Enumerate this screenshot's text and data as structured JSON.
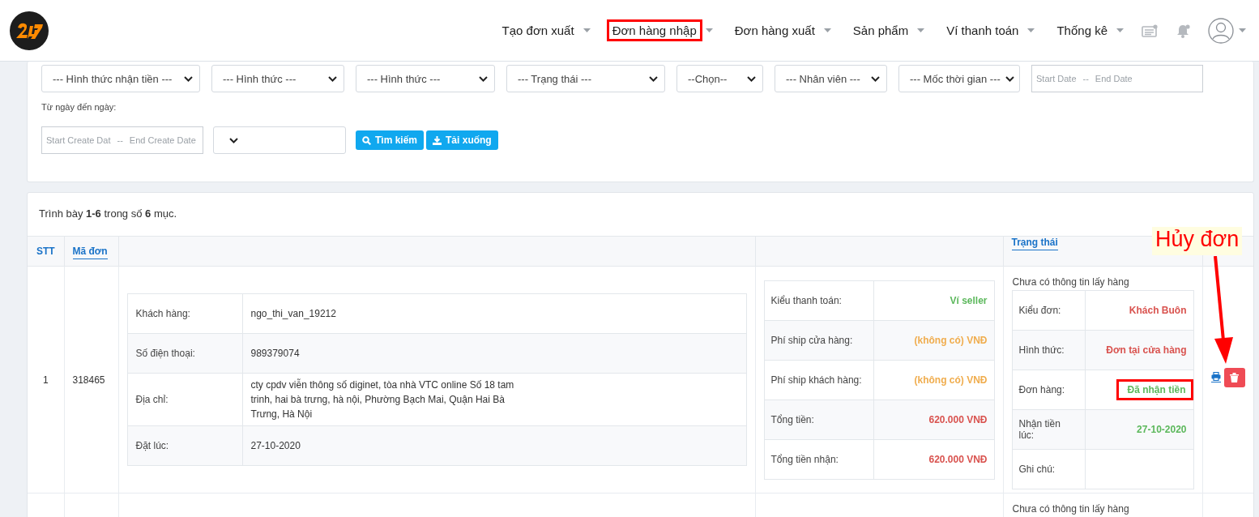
{
  "header": {
    "nav": [
      {
        "label": "Tạo đơn xuất",
        "highlighted": false
      },
      {
        "label": "Đơn hàng nhập",
        "highlighted": true
      },
      {
        "label": "Đơn hàng xuất",
        "highlighted": false
      },
      {
        "label": "Sản phẩm",
        "highlighted": false
      },
      {
        "label": "Ví thanh toán",
        "highlighted": false
      },
      {
        "label": "Thống kê",
        "highlighted": false
      }
    ]
  },
  "filters": {
    "selects": [
      {
        "value": "--- Hình thức nhận tiền ---",
        "kind": "wide"
      },
      {
        "value": "--- Hình thức ---",
        "kind": "wide"
      },
      {
        "value": "--- Hình thức ---",
        "kind": "wide"
      },
      {
        "value": "--- Trạng thái ---",
        "kind": "wide"
      },
      {
        "value": "--Chọn--",
        "kind": "narrow"
      },
      {
        "value": "--- Nhân viên ---",
        "kind": "mid"
      },
      {
        "value": "--- Mốc thời gian ---",
        "kind": "mid"
      }
    ],
    "date_range": {
      "start_placeholder": "Start Date",
      "separator": "--",
      "end_placeholder": "End Date"
    },
    "date_label": "Từ ngày đến ngày:",
    "create_range": {
      "start_placeholder": "Start Create Dat",
      "separator": "--",
      "end_placeholder": "End Create Date"
    },
    "buttons": [
      {
        "label": "Tìm kiếm",
        "kind": "search"
      },
      {
        "label": "Tải xuống",
        "kind": "download"
      }
    ]
  },
  "table": {
    "summary": "Trình bày **1-6** trong số **6** mục.",
    "columns": [
      {
        "label": "STT",
        "kind": "plain"
      },
      {
        "label": "Mã đơn",
        "kind": "link"
      },
      {
        "kind": "empty"
      },
      {
        "kind": "empty"
      },
      {
        "label": "Trạng thái",
        "kind": "link"
      },
      {
        "kind": "empty"
      }
    ],
    "rows": [
      {
        "stt": "1",
        "code": "318465",
        "customer": [
          {
            "label": "Khách hàng:",
            "value": "ngo_thi_van_19212"
          },
          {
            "label": "Số điện thoại:",
            "value": "989379074"
          },
          {
            "label": "Địa chỉ:",
            "value": "cty cpdv viễn thông số diginet, tòa nhà VTC online Số 18 tam trinh, hai bà trưng, hà nội, Phường Bạch Mai, Quận Hai Bà Trưng, Hà Nội"
          },
          {
            "label": "Đặt lúc:",
            "value": "27-10-2020"
          }
        ],
        "payment": [
          {
            "label": "Kiểu thanh toán:",
            "value": "Ví seller",
            "color": "#5cb85c"
          },
          {
            "label": "Phí ship cửa hàng:",
            "value": "(không có) VNĐ",
            "color": "#f0ad4e"
          },
          {
            "label": "Phí ship khách hàng:",
            "value": "(không có) VNĐ",
            "color": "#f0ad4e"
          },
          {
            "label": "Tổng tiền:",
            "value": "620.000 VNĐ",
            "color": "#d9534f"
          },
          {
            "label": "Tổng tiền nhận:",
            "value": "620.000 VNĐ",
            "color": "#d9534f"
          }
        ],
        "pickup_note": "Chưa có thông tin lấy hàng",
        "status": [
          {
            "label": "Kiểu đơn:",
            "value": "Khách Buôn",
            "color": "#d9534f",
            "highlighted": false
          },
          {
            "label": "Hình thức:",
            "value": "Đơn tại cửa hàng",
            "color": "#d9534f",
            "highlighted": false
          },
          {
            "label": "Đơn hàng:",
            "value": "Đã nhận tiền",
            "color": "#5cb85c",
            "highlighted": true
          },
          {
            "label": "Nhận tiền lúc:",
            "value": "27-10-2020",
            "color": "#5cb85c",
            "highlighted": false
          },
          {
            "label": "Ghi chú:"
          }
        ],
        "actions": true
      },
      {
        "pickup_note": "Chưa có thông tin lấy hàng"
      }
    ]
  },
  "annotation": {
    "label": "Hủy đơn"
  }
}
